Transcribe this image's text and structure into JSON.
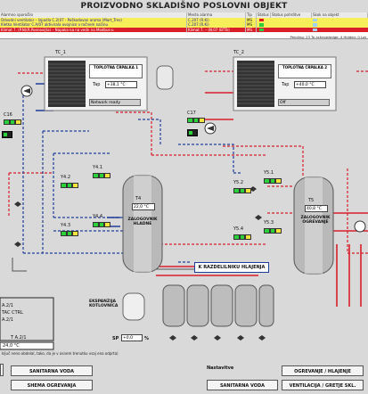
{
  "title": "PROIZVODNO SKLADIŠNO POSLOVNI OBJEKT",
  "alarms": {
    "headers": [
      "Alarmno sporočilo",
      "Mesto alarma",
      "Tip",
      "Status",
      "Status potrditve",
      "Skok na objekt"
    ],
    "rows": [
      [
        "Odvodni ventilator – Izpadla C.2(07 - Poškodovan aroma (Mart_Tres)",
        "C.207 (R.Ki)",
        "MS",
        "",
        "",
        ""
      ],
      [
        "Kletka Ventilator C.A/07 aktivirala ovojnice v ročnem načinu",
        "C.207 (R.Ki)",
        "MS",
        "",
        "",
        ""
      ],
      [
        "Klimat 7. (P.N)(R.Poenovijta) – Napaka na na vedn na Modbus-u",
        "Klimat 7. – (N.07 (BTTs)",
        "MS",
        "",
        "",
        ""
      ]
    ],
    "pending": "Pending: 23   To acknowledge: 4   Hidden: 0   Lat"
  },
  "diagram": {
    "tc1": {
      "label": "TC_1",
      "panel_title": "TOPLOTNA ČRPALKA 1",
      "tap_label": "Tap",
      "tap_value": "+38,1 °C",
      "status": "Network ready"
    },
    "tc2": {
      "label": "TC_2",
      "panel_title": "TOPLOTNA ČRPALKA 2",
      "tap_label": "Tap",
      "tap_value": "+40,0 °C",
      "status": "Off"
    },
    "c16": "C16",
    "c17": "C17",
    "y41": "Y4.1",
    "y42": "Y4.2",
    "y43": "Y4.3",
    "y44": "Y4.4",
    "y51": "Y5.1",
    "y52": "Y5.2",
    "y53": "Y5.3",
    "y54": "Y5.4",
    "t4": {
      "label": "T4",
      "value": "22,0 °C",
      "title": "ZALOGOVNIK HLADNE"
    },
    "t5": {
      "label": "T5",
      "value": "40,8 °C",
      "title": "ZALOGOVNIK OGREVANJE"
    },
    "manifold_button": "K RAZDELILNIKU HLAJENJA",
    "expansion": "EKSPANZIJA KOTLOVNICA",
    "sp_label": "SP",
    "sp_value": "+0,0",
    "sp_unit": "%",
    "left_panel": {
      "l1": "A.2/1",
      "l2": "TAC CTRL",
      "l3": "A.2/1",
      "l4": "T A.2/1",
      "l5": "24,0 °C"
    },
    "note": "ključ neno obdelal, tako, da je v osnem trenutku vsaj ena odprta)"
  },
  "bottom": {
    "left_buttons": [
      "SANITARNA VODA",
      "SHEMA OGREVANJA"
    ],
    "nastavitve": "Nastavitve",
    "right_buttons": [
      "OGREVANJE / HLAJENJE",
      "SANITARNA VODA",
      "VENTILACIJA / GRETJE SKL."
    ]
  },
  "colors": {
    "hot_pipe": "#d81f2a",
    "cold_pipe": "#1f3e9b",
    "ok": "#2bd13b",
    "warn": "#f3e33d",
    "alarm": "#d81f2a"
  }
}
